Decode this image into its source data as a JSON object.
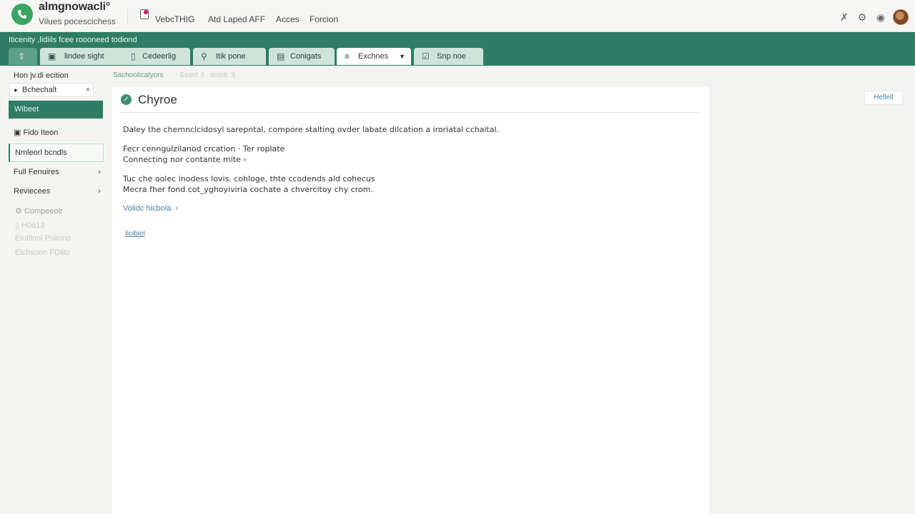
{
  "header": {
    "brand_title": "almgnowacli°",
    "brand_subtitle": "Vilues pocescichess",
    "nav": [
      "VebcTHIG",
      "Atd Laped AFF",
      "Acces",
      "Forcion"
    ],
    "right_icons": [
      "tools-icon",
      "settings-icon",
      "help-icon"
    ]
  },
  "greenbar": {
    "breadcrumb": "Iticenity ,lidiils fcee roooneed todiond"
  },
  "tabs": [
    {
      "label": "",
      "icon": "home-icon"
    },
    {
      "label": "lindee sight",
      "icon": "image-icon"
    },
    {
      "label": "Cedeerlig",
      "icon": "document-icon"
    },
    {
      "label": "Itik pone",
      "icon": "pin-icon"
    },
    {
      "label": "Conigats",
      "icon": "box-icon"
    },
    {
      "label": "Exchnes",
      "icon": "list-icon",
      "active": true
    },
    {
      "label": "Snp noe",
      "icon": "check-box-icon"
    }
  ],
  "sidebar": {
    "heading": "Hon jv.di ecition",
    "filter_value": "Bchechalt",
    "active_item": "Wibeet",
    "items": [
      {
        "label": "Fido Iteon"
      },
      {
        "label": "Nmleorl bcndls"
      },
      {
        "label": "Full Fenuires"
      },
      {
        "label": "Reviecees"
      }
    ],
    "faded_items": [
      "Compeeolr",
      "H0613",
      "Elutilonl Pniinno",
      "Elchsoon FDlito"
    ]
  },
  "content": {
    "breadcrumb": "Sachoolicatyors",
    "breadcrumb_faded": "Eeecl :I · doeitr :ll",
    "title": "Chyroe",
    "paragraph1": "Daley the chemnclcidosyl sarepntal, compore stalting ovder labate dilcation a iroriatal cchaital.",
    "line2a": "Fecr cenngulzilanod crcation · Ter roplate",
    "line2b": "Connecting nor contante mite ›",
    "line3a": "Tuc che oolec inodess lovis. cohloge, thte ccodends ald cohecus",
    "line3b": "Mecra fher fond cot_yghoyiviria  cochate a chvercitoy chy crom.",
    "link1": "Volidc hicbola. ›",
    "link2": "Iicibiel"
  },
  "right_button": "Hellell"
}
